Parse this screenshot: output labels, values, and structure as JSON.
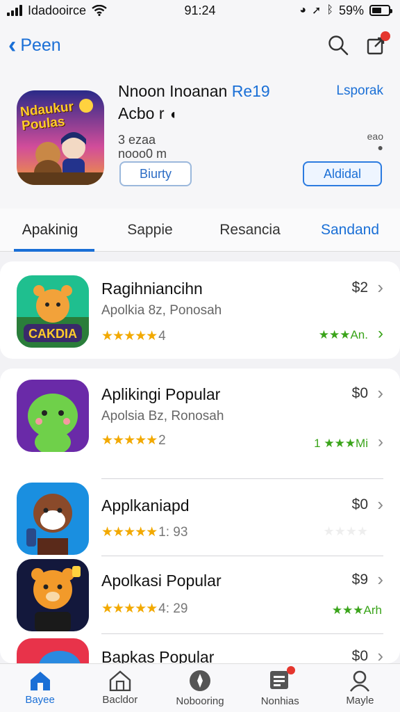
{
  "status": {
    "carrier": "Idadooirce",
    "time": "91:24",
    "battery": "59%"
  },
  "nav": {
    "back_label": "Peen"
  },
  "app": {
    "title": "Nnoon Inoanan",
    "title_accent": "Re19",
    "subtitle": "Acbo r",
    "meta": "3 ezaa\nnooo0 m",
    "link": "Lsporak",
    "meta_right": "eao",
    "get_label": "Biurty",
    "add_label": "Aldidal",
    "icon_text": "Ndaukur Poulas"
  },
  "tabs": [
    {
      "label": "Apakinig"
    },
    {
      "label": "Sappie"
    },
    {
      "label": "Resancia"
    },
    {
      "label": "Sandand"
    }
  ],
  "list": [
    {
      "name": "Ragihniancihn",
      "sub": "Apolkia 8z, Ponosah",
      "stars": "★★★★★",
      "rating": "4",
      "price": "$2",
      "right_rating": "★★★An.",
      "icon_text": "CAKDIA"
    },
    {
      "name": "Aplikingi Popular",
      "sub": "Apolsia Bz, Ronosah",
      "stars": "★★★★★",
      "rating": "2",
      "price": "$0",
      "right_rating": "1 ★★★Mi"
    },
    {
      "name": "Applkaniapd",
      "sub": "",
      "stars": "★★★★★",
      "rating": "1: 93",
      "price": "$0",
      "right_rating": ""
    },
    {
      "name": "Apolkasi Popular",
      "sub": "",
      "stars": "★★★★★",
      "rating": "4: 29",
      "price": "$9",
      "right_rating": "★★★Arh"
    },
    {
      "name": "Bapkas Popular",
      "sub": "",
      "stars": "",
      "rating": "",
      "price": "$0",
      "right_rating": ""
    }
  ],
  "bottom": [
    {
      "label": "Bayee",
      "icon": "home-icon"
    },
    {
      "label": "Bacldor",
      "icon": "store-icon"
    },
    {
      "label": "Nobooring",
      "icon": "compass-icon"
    },
    {
      "label": "Nonhias",
      "icon": "inbox-icon"
    },
    {
      "label": "Mayle",
      "icon": "profile-icon"
    }
  ],
  "colors": {
    "accent": "#1a6fd6",
    "star": "#f2a900",
    "green": "#3aa41a",
    "badge": "#e5362e"
  }
}
